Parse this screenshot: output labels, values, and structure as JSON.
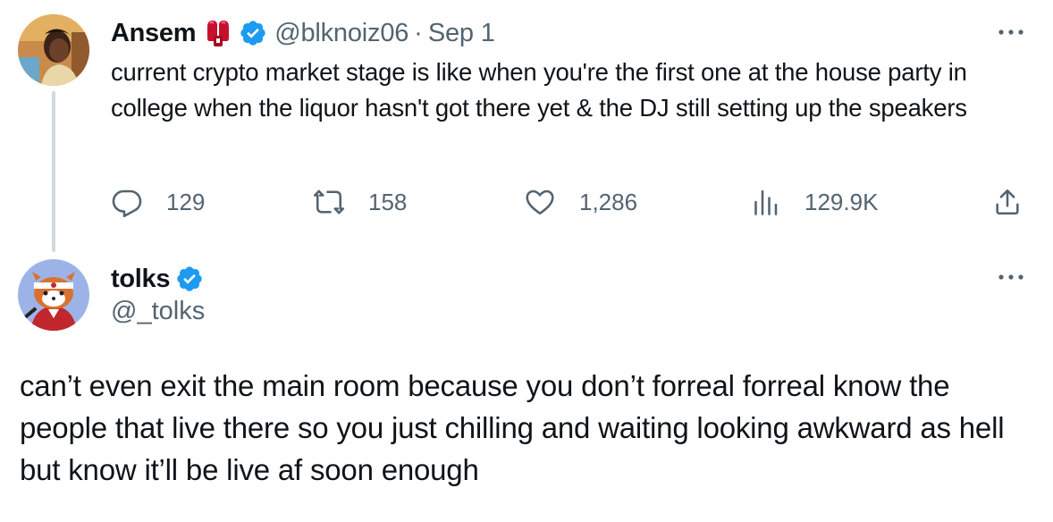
{
  "colors": {
    "text": "#0f1419",
    "secondary": "#536471",
    "verified": "#1d9bf0",
    "thread_line": "#cfd9de"
  },
  "parent_tweet": {
    "author_name": "Ansem",
    "name_emoji": "boxing-glove-icon",
    "verified": true,
    "handle": "@blknoiz06",
    "separator": "·",
    "date": "Sep 1",
    "text": "current crypto market stage is like when you're the first one at the house party in college when the liquor hasn't got there yet & the DJ still setting up the speakers",
    "actions": {
      "replies": "129",
      "reposts": "158",
      "likes": "1,286",
      "views": "129.9K"
    },
    "icons": [
      "reply-icon",
      "repost-icon",
      "like-icon",
      "views-icon",
      "share-icon",
      "more-icon"
    ]
  },
  "reply_tweet": {
    "author_name": "tolks",
    "verified": true,
    "handle": "@_tolks",
    "text": "can’t even exit the main room because you don’t forreal forreal know the people that live there so you just chilling and waiting looking awkward as hell but know it’ll be live af soon enough",
    "icons": [
      "more-icon"
    ]
  }
}
